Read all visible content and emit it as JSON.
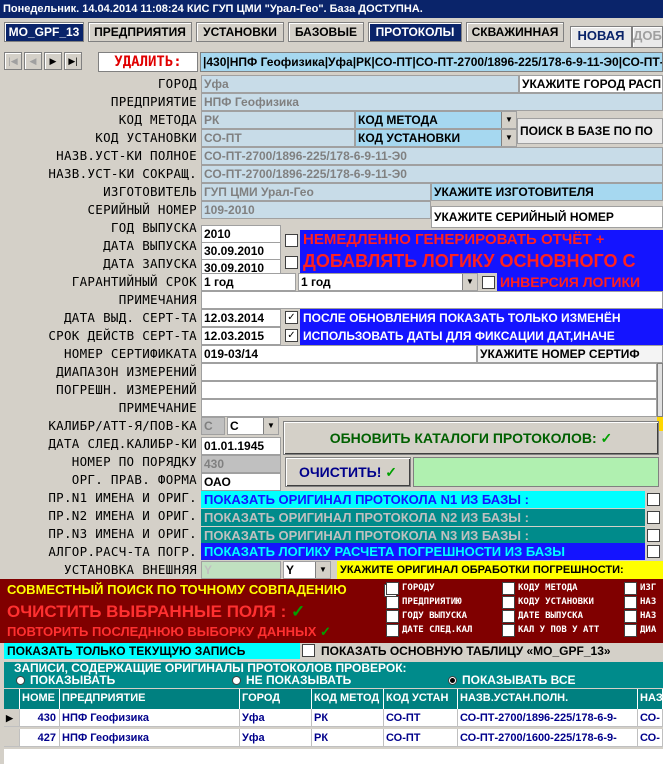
{
  "window": {
    "title": "Понедельник. 14.04.2014 11:08:24  КИС ГУП ЦМИ \"Урал-Гео\". База ДОСТУПНА."
  },
  "tabs": [
    "MO_GPF_13",
    "ПРЕДПРИЯТИЯ",
    "УСТАНОВКИ",
    "БАЗОВЫЕ",
    "ПРОТОКОЛЫ",
    "СКВАЖИННАЯ",
    "НОВАЯ",
    "ДОБ"
  ],
  "nav": {
    "first": "|◀",
    "prev": "◀",
    "next": "▶",
    "last": "▶|",
    "delete_label": "УДАЛИТЬ:",
    "record": "|430|НПФ Геофизика|Уфа|РК|СО-ПТ|СО-ПТ-2700/1896-225/178-6-9-11-Э0|СО-ПТ-2700/1896-225/178-6-9-11-Э0|"
  },
  "labels": {
    "city": "ГОРОД",
    "company": "ПРЕДПРИЯТИЕ",
    "method_code": "КОД МЕТОДА",
    "install_code": "КОД УСТАНОВКИ",
    "name_full": "НАЗВ.УСТ-КИ ПОЛНОЕ",
    "name_short": "НАЗВ.УСТ-КИ СОКРАЩ.",
    "maker": "ИЗГОТОВИТЕЛЬ",
    "serial": "СЕРИЙНЫЙ НОМЕР",
    "year": "ГОД ВЫПУСКА",
    "release_date": "ДАТА ВЫПУСКА",
    "start_date": "ДАТА ЗАПУСКА",
    "warranty": "ГАРАНТИЙНЫЙ СРОК",
    "notes": "ПРИМЕЧАНИЯ",
    "cert_date": "ДАТА ВЫД. СЕРТ-ТА",
    "cert_valid": "СРОК ДЕЙСТВ СЕРТ-ТА",
    "cert_no": "НОМЕР СЕРТИФИКАТА",
    "range": "ДИАПАЗОН ИЗМЕРЕНИЙ",
    "error": "ПОГРЕШН. ИЗМЕРЕНИЙ",
    "note": "ПРИМЕЧАНИЕ",
    "calib": "КАЛИБР/АТТ-Я/ПОВ-КА",
    "next_calib": "ДАТА СЛЕД.КАЛИБР-КИ",
    "order_no": "НОМЕР ПО ПОРЯДКУ",
    "legal_form": "ОРГ. ПРАВ. ФОРМА",
    "n1": "ПР.N1 ИМЕНА И ОРИГ.",
    "n2": "ПР.N2 ИМЕНА И ОРИГ.",
    "n3": "ПР.N3 ИМЕНА И ОРИГ.",
    "algo": "АЛГОР.РАСЧ-ТА ПОГР.",
    "external": "УСТАНОВКА ВНЕШНЯЯ"
  },
  "values": {
    "city": "Уфа",
    "company": "НПФ Геофизика",
    "method_code": "РК",
    "install_code": "СО-ПТ",
    "name_full": "СО-ПТ-2700/1896-225/178-6-9-11-Э0",
    "name_short": "СО-ПТ-2700/1896-225/178-6-9-11-Э0",
    "maker": "ГУП ЦМИ Урал-Гео",
    "serial": "109-2010",
    "year": "2010",
    "release_date": "30.09.2010",
    "start_date": "30.09.2010",
    "warranty": "1 год",
    "warranty_sel": "1 год",
    "cert_date": "12.03.2014",
    "cert_valid": "12.03.2015",
    "cert_no": "019-03/14",
    "calib": "С",
    "calib_sel": "С",
    "next_calib": "01.01.1945",
    "order_no": "430",
    "legal_form": "ОАО",
    "external": "Y",
    "external_sel": "Y"
  },
  "hints": {
    "city": "УКАЖИТЕ ГОРОД РАСП",
    "method": "КОД МЕТОДА",
    "install": "КОД УСТАНОВКИ",
    "search": "ПОИСК В БАЗЕ ПО ПО",
    "maker": "УКАЖИТЕ ИЗГОТОВИТЕЛЯ",
    "serial": "УКАЖИТЕ СЕРИЙНЫЙ НОМЕР",
    "cert_no": "УКАЖИТЕ НОМЕР СЕРТИФ"
  },
  "options": {
    "gen_report": "НЕМЕДЛЕННО ГЕНЕРИРОВАТЬ ОТЧЁТ +",
    "add_logic": "ДОБАВЛЯТЬ ЛОГИКУ ОСНОВНОГО С",
    "invert": "ИНВЕРСИЯ ЛОГИКИ",
    "after_update": "ПОСЛЕ ОБНОВЛЕНИЯ ПОКАЗАТЬ ТОЛЬКО ИЗМЕНЁН",
    "use_dates": "ИСПОЛЬЗОВАТЬ ДАТЫ ДЛЯ ФИКСАЦИИ ДАТ,ИНАЧЕ"
  },
  "buttons": {
    "update_catalogs": "ОБНОВИТЬ КАТАЛОГИ ПРОТОКОЛОВ:",
    "clear": "ОЧИСТИТЬ!",
    "show_n1": "ПОКАЗАТЬ ОРИГИНАЛ ПРОТОКОЛА N1 ИЗ БАЗЫ :",
    "show_n2": "ПОКАЗАТЬ ОРИГИНАЛ ПРОТОКОЛА N2 ИЗ БАЗЫ :",
    "show_n3": "ПОКАЗАТЬ ОРИГИНАЛ ПРОТОКОЛА N3 ИЗ БАЗЫ :",
    "show_logic": "ПОКАЗАТЬ ЛОГИКУ РАСЧЕТА ПОГРЕШНОСТИ ИЗ БАЗЫ",
    "specify_orig": "УКАЖИТЕ ОРИГИНАЛ ОБРАБОТКИ ПОГРЕШНОСТИ:",
    "joint_search": "СОВМЕСТНЫЙ ПОИСК ПО ТОЧНОМУ СОВПАДЕНИЮ",
    "clear_fields": "ОЧИСТИТЬ ВЫБРАННЫЕ ПОЛЯ :",
    "repeat": "ПОВТОРИТЬ ПОСЛЕДНЮЮ ВЫБОРКУ ДАННЫХ",
    "only_current": "ПОКАЗАТЬ ТОЛЬКО ТЕКУЩУЮ ЗАПИСЬ",
    "show_main": "ПОКАЗАТЬ ОСНОВНУЮ ТАБЛИЦУ «MO_GPF_13»"
  },
  "filters": [
    "ГОРОДУ",
    "ПРЕДПРИЯТИЮ",
    "ГОДУ ВЫПУСКА",
    "ДАТЕ СЛЕД.КАЛ",
    "КОДУ МЕТОДА",
    "КОДУ УСТАНОВКИ",
    "ДАТЕ ВЫПУСКА",
    "КАЛ У ПОВ У АТТ",
    "ИЗГ",
    "НАЗ",
    "НАЗ",
    "ДИА"
  ],
  "records": {
    "caption": "ЗАПИСИ, СОДЕРЖАЩИЕ ОРИГИНАЛЫ ПРОТОКОЛОВ ПРОВЕРОК:",
    "show": "ПОКАЗЫВАТЬ",
    "no_show": "НЕ ПОКАЗЫВАТЬ",
    "show_all": "ПОКАЗЫВАТЬ ВСЕ"
  },
  "grid": {
    "headers": [
      "НОМЕ",
      "ПРЕДПРИЯТИЕ",
      "ГОРОД",
      "КОД МЕТОД",
      "КОД УСТАН",
      "НАЗВ.УСТАН.ПОЛН.",
      "НАЗ"
    ],
    "rows": [
      [
        "430",
        "НПФ Геофизика",
        "Уфа",
        "РК",
        "СО-ПТ",
        "СО-ПТ-2700/1896-225/178-6-9-",
        "СО-"
      ],
      [
        "427",
        "НПФ Геофизика",
        "Уфа",
        "РК",
        "СО-ПТ",
        "СО-ПТ-2700/1600-225/178-6-9-",
        "СО-"
      ]
    ]
  }
}
